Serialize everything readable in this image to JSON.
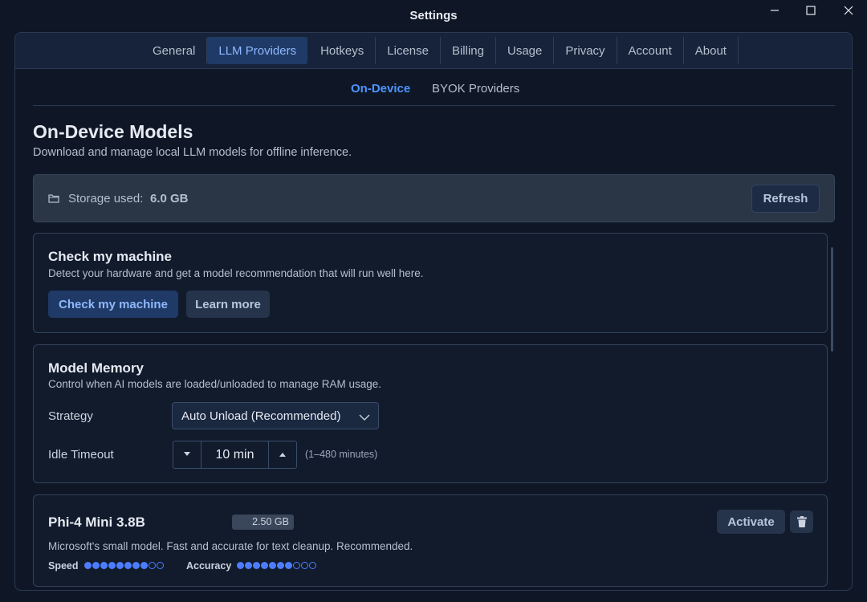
{
  "window": {
    "title": "Settings"
  },
  "tabs": [
    {
      "label": "General"
    },
    {
      "label": "LLM Providers",
      "active": true
    },
    {
      "label": "Hotkeys"
    },
    {
      "label": "License"
    },
    {
      "label": "Billing"
    },
    {
      "label": "Usage"
    },
    {
      "label": "Privacy"
    },
    {
      "label": "Account"
    },
    {
      "label": "About"
    }
  ],
  "subtabs": [
    {
      "label": "On-Device",
      "active": true
    },
    {
      "label": "BYOK Providers"
    }
  ],
  "section": {
    "title": "On-Device Models",
    "description": "Download and manage local LLM models for offline inference."
  },
  "storage": {
    "label": "Storage used:",
    "value": "6.0 GB",
    "refresh_label": "Refresh",
    "icon": "folder-icon"
  },
  "check_card": {
    "title": "Check my machine",
    "description": "Detect your hardware and get a model recommendation that will run well here.",
    "primary_label": "Check my machine",
    "secondary_label": "Learn more"
  },
  "memory_card": {
    "title": "Model Memory",
    "description": "Control when AI models are loaded/unloaded to manage RAM usage.",
    "strategy_label": "Strategy",
    "strategy_value": "Auto Unload (Recommended)",
    "idle_label": "Idle Timeout",
    "idle_value": "10 min",
    "idle_hint": "(1–480 minutes)"
  },
  "model": {
    "name": "Phi-4 Mini 3.8B",
    "size": "2.50 GB",
    "description": "Microsoft's small model. Fast and accurate for text cleanup. Recommended.",
    "activate_label": "Activate",
    "speed_label": "Speed",
    "speed_rating": 8,
    "accuracy_label": "Accuracy",
    "accuracy_rating": 7,
    "rating_max": 10
  },
  "colors": {
    "accent": "#4d94ff",
    "background": "#0f1726",
    "tabbar": "#17233a"
  }
}
